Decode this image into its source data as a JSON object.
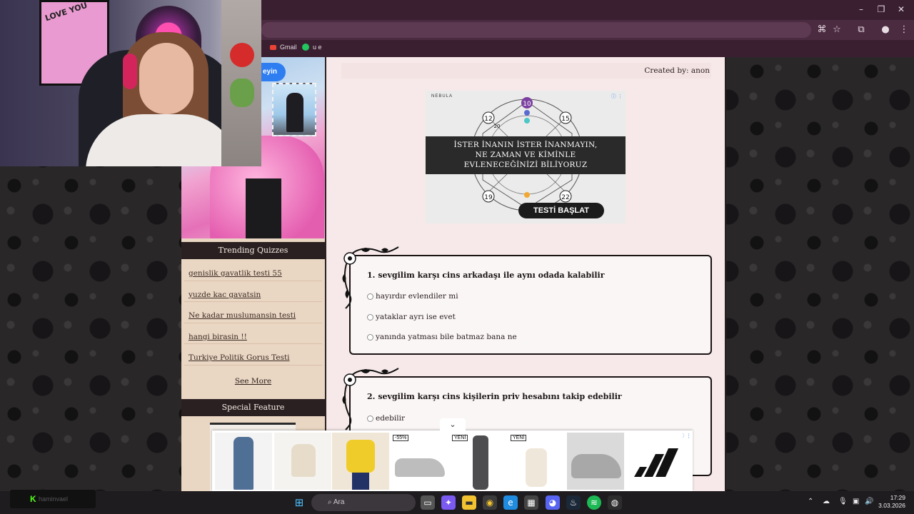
{
  "bookmarks": [
    {
      "label": "Gmail",
      "icon": "gmail-icon",
      "color": "#ea4335"
    },
    {
      "label": "u e",
      "icon": "green-dot-icon",
      "color": "#22c55e"
    }
  ],
  "sidebar": {
    "blue_button_label": "eyin",
    "trending_title": "Trending Quizzes",
    "trending_items": [
      "genislik gavatlik testi 55",
      "yuzde kac gavatsin",
      "Ne kadar muslumansin testi",
      "hangi birasin !!",
      "Turkiye Politik Gorus Testi"
    ],
    "see_more": "See More",
    "special_title": "Special Feature"
  },
  "main": {
    "created_by": "Created by: anon",
    "ad": {
      "brand": "NEBULA",
      "headline_1": "İSTER İNANIN İSTER İNANMAYIN,",
      "headline_2": "NE ZAMAN VE KİMİNLE",
      "headline_3": "EVLENECEĞİNİZİ BİLİYORUZ",
      "cta": "TESTİ BAŞLAT",
      "numbers": [
        "10",
        "12",
        "15",
        "20",
        "19",
        "22"
      ]
    },
    "questions": [
      {
        "title": "1. sevgilim karşı cins arkadaşı ile aynı odada kalabilir",
        "options": [
          "hayırdır evlendiler mi",
          "yataklar ayrı ise evet",
          "yanında yatması bile batmaz bana ne"
        ]
      },
      {
        "title": "2. sevgilim karşı cins kişilerin priv hesabını takip edebilir",
        "options": [
          "edebilir"
        ]
      }
    ]
  },
  "shop_ad": {
    "tags": [
      "-55%",
      "YENİ",
      "YENİ"
    ],
    "collapse_icon": "chevron-down-icon",
    "brand": "adidas-logo"
  },
  "taskbar": {
    "search_placeholder": "Ara",
    "time": "17:29",
    "date": "3.03.2026",
    "stream_label": "haminvael"
  },
  "colors": {
    "title_bar": "#3a1f31",
    "main_bg": "#f7e9e9",
    "sidebar_bg": "#e9d6c3",
    "panel_head": "#2b2021"
  }
}
